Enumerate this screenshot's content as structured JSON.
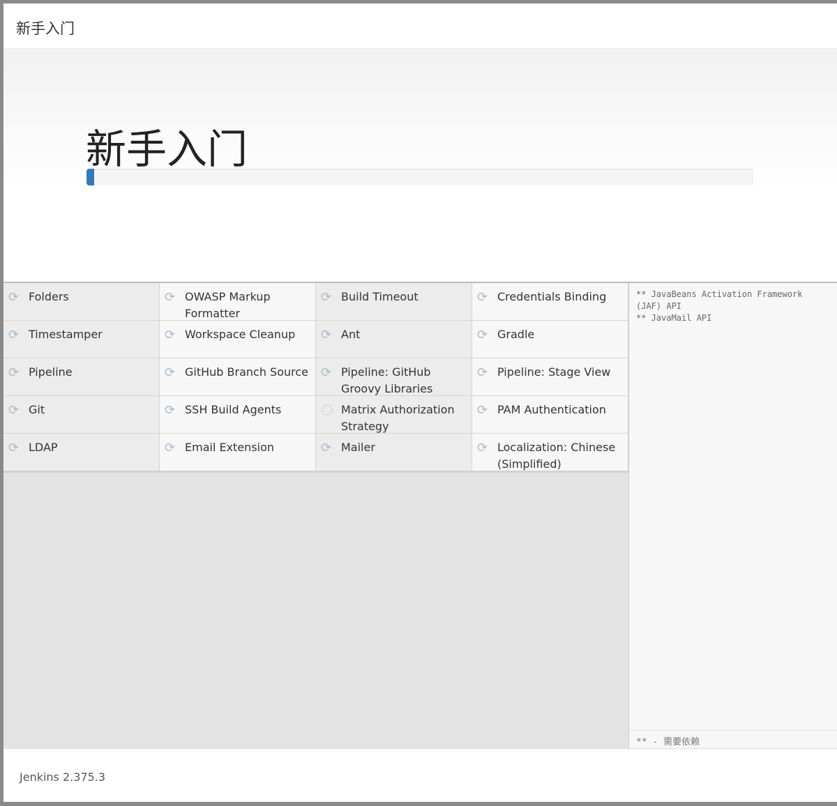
{
  "header": {
    "title": "新手入门"
  },
  "hero": {
    "title": "新手入门",
    "progress_percent": 1.2,
    "accent": "#337ab7"
  },
  "plugins": [
    {
      "name": "Folders",
      "status": "installing"
    },
    {
      "name": "OWASP Markup Formatter",
      "status": "installing"
    },
    {
      "name": "Build Timeout",
      "status": "installing"
    },
    {
      "name": "Credentials Binding",
      "status": "installing"
    },
    {
      "name": "Timestamper",
      "status": "installing"
    },
    {
      "name": "Workspace Cleanup",
      "status": "installing"
    },
    {
      "name": "Ant",
      "status": "installing"
    },
    {
      "name": "Gradle",
      "status": "installing"
    },
    {
      "name": "Pipeline",
      "status": "installing"
    },
    {
      "name": "GitHub Branch Source",
      "status": "installing"
    },
    {
      "name": "Pipeline: GitHub Groovy Libraries",
      "status": "installing"
    },
    {
      "name": "Pipeline: Stage View",
      "status": "installing"
    },
    {
      "name": "Git",
      "status": "installing"
    },
    {
      "name": "SSH Build Agents",
      "status": "installing"
    },
    {
      "name": "Matrix Authorization Strategy",
      "status": "pending"
    },
    {
      "name": "PAM Authentication",
      "status": "installing"
    },
    {
      "name": "LDAP",
      "status": "installing"
    },
    {
      "name": "Email Extension",
      "status": "installing"
    },
    {
      "name": "Mailer",
      "status": "installing"
    },
    {
      "name": "Localization: Chinese (Simplified)",
      "status": "installing"
    }
  ],
  "log": {
    "text": "** JavaBeans Activation Framework (JAF) API\n** JavaMail API",
    "legend": "** - 需要依赖"
  },
  "footer": {
    "version": "Jenkins 2.375.3"
  }
}
